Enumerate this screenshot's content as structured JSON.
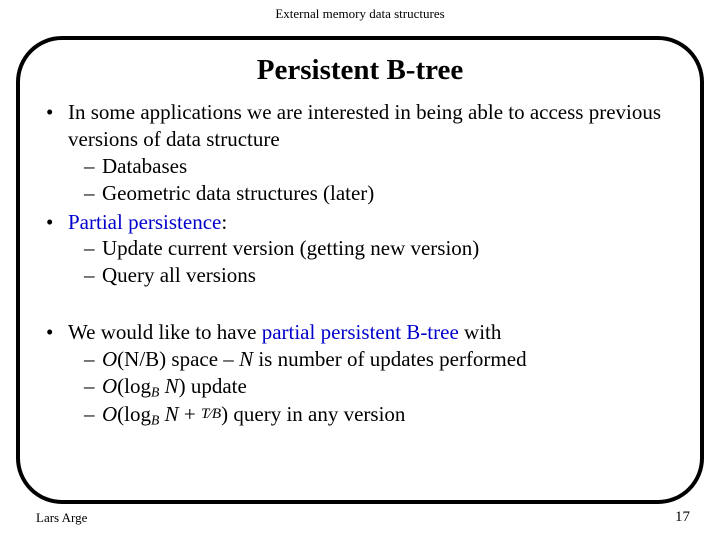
{
  "header": "External memory data structures",
  "title": "Persistent B-tree",
  "bullets": {
    "b1": "In some applications we are interested in being able to access previous versions of data structure",
    "b1s1": "Databases",
    "b1s2": "Geometric data structures (later)",
    "b2": "Partial persistence",
    "b2colon": ":",
    "b2s1": "Update current version (getting new version)",
    "b2s2": "Query all versions",
    "b3a": "We would like to have ",
    "b3b": "partial persistent B-tree",
    "b3c": " with",
    "b3s1a": "O",
    "b3s1b": "(N/B)",
    "b3s1c": " space – ",
    "b3s1d": "N",
    "b3s1e": " is number of updates performed",
    "b3s2_update": " update",
    "b3s3_query": " query in any version",
    "logB_O": "O",
    "logB_open": "(log",
    "logB_B": "B",
    "logB_N": " N",
    "logB_close": ")",
    "plus": " + ",
    "T": "T",
    "slashB": "B"
  },
  "footer": {
    "author": "Lars Arge",
    "page": "17"
  }
}
